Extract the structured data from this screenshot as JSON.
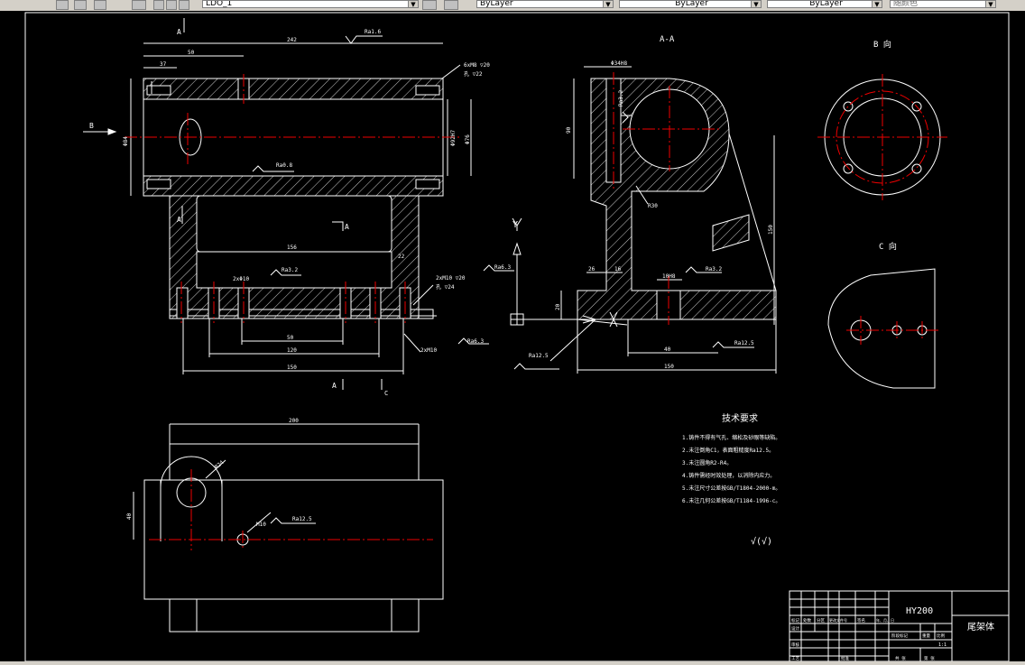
{
  "toolbar": {
    "layer_name": "LDO_1",
    "color_value": "ByLayer",
    "linetype_value": "ByLayer",
    "lineweight_value": "ByLayer",
    "plotstyle_value": "随颜色"
  },
  "drawing": {
    "section_marks": {
      "a_top": "A",
      "a_mid": "A",
      "a_right": "A",
      "a_bottom": "A"
    },
    "view_titles": {
      "section_aa": "A-A",
      "view_b": "B 向",
      "view_c": "C 向"
    },
    "arrow_labels": {
      "b": "B",
      "c": "C",
      "y": "Y"
    },
    "front_view": {
      "dim_overall": "242",
      "dim_50": "50",
      "dim_37": "37",
      "dim_156": "156",
      "dim_22": "22",
      "dim_50b": "50",
      "dim_120": "120",
      "dim_150": "150",
      "dim_left_dia": "Φ84",
      "dim_bore": "Φ92H7",
      "dim_76": "Φ76",
      "rough_top": "Ra1.6",
      "rough_mid": "Ra0.8",
      "rough_a": "Ra3.2",
      "rough_b": "Ra6.3",
      "rough_c": "Ra6.3",
      "hole_callout_1": "6xM8 ▽20",
      "hole_callout_1b": "孔 ▽22",
      "hole_callout_2": "2xM10 ▽20",
      "hole_callout_2b": "孔 ▽24",
      "hole_callout_3": "2xΦ10",
      "hole_callout_4": "2xM10"
    },
    "section_view": {
      "dim_dia": "Φ34H8",
      "rough_r": "Ra3.2",
      "dim_r": "R30",
      "dim_h": "90",
      "dim_26": "26",
      "dim_16": "16",
      "dim_10": "10H8",
      "rough_s": "Ra3.2",
      "dim_20": "20",
      "dim_40": "40",
      "dim_150": "150",
      "rough_bot": "Ra12.5",
      "rough_left": "Ra12.5",
      "dim_height": "150"
    },
    "top_view": {
      "dim_200": "200",
      "dim_r": "R24",
      "dim_40": "40",
      "dim_m10": "M10",
      "rough": "Ra12.5"
    },
    "tech_req": {
      "title": "技术要求",
      "items": [
        "1.铸件不得有气孔、缩松及砂眼等缺陷。",
        "2.未注倒角C1，表面粗糙度Ra12.5。",
        "3.未注圆角R2-R4。",
        "4.铸件需经时效处理，以消除内应力。",
        "5.未注尺寸公差按GB/T1804-2000-m。",
        "6.未注几何公差按GB/T1184-1996-c。"
      ],
      "general_rough": "√(√)"
    },
    "title_block": {
      "model": "HY200",
      "part_name": "尾架体",
      "scale": "1:1",
      "row_labels": [
        "标记",
        "处数",
        "分区",
        "更改文件号",
        "签名",
        "年、月、日"
      ],
      "left_labels": [
        "设计",
        "审核",
        "工艺"
      ],
      "stage_labels": [
        "阶段标记",
        "重量",
        "比例"
      ],
      "bottom_labels": [
        "批准",
        "共 张",
        "第 张"
      ]
    }
  }
}
